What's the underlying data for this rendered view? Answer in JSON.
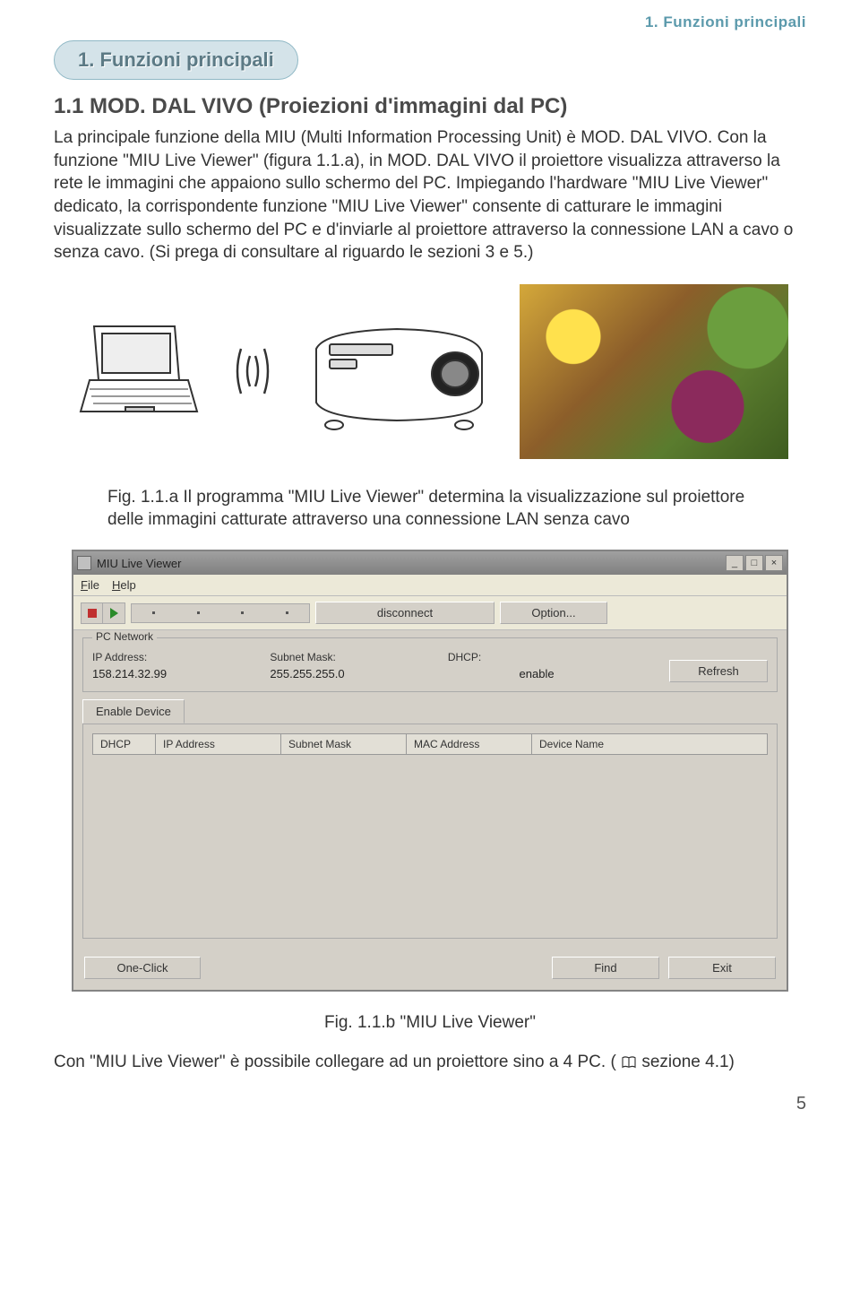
{
  "header": {
    "running_title": "1. Funzioni principali"
  },
  "section_pill": "1. Funzioni principali",
  "section_title": "1.1 MOD. DAL VIVO (Proiezioni d'immagini dal PC)",
  "body_paragraph": "La principale funzione della MIU (Multi Information Processing Unit) è MOD. DAL VIVO.\nCon la funzione \"MIU Live Viewer\" (figura 1.1.a), in MOD. DAL VIVO il proiettore visualizza attraverso la rete le immagini che appaiono sullo schermo del PC. Impiegando l'hardware \"MIU Live Viewer\" dedicato, la corrispondente funzione \"MIU Live Viewer\" consente di catturare le immagini visualizzate sullo schermo del PC e d'inviarle al proiettore attraverso la connessione LAN a cavo o senza cavo. (Si prega di consultare al riguardo le sezioni 3 e 5.)",
  "fig_a_caption": "Fig. 1.1.a Il programma \"MIU Live Viewer\" determina la visualizzazione sul proiettore delle immagini catturate attraverso una connessione LAN senza cavo",
  "app": {
    "title": "MIU Live Viewer",
    "menus": {
      "file": "File",
      "help": "Help"
    },
    "toolbar": {
      "disconnect": "disconnect",
      "option": "Option..."
    },
    "pc_network": {
      "legend": "PC Network",
      "ip_label": "IP Address:",
      "ip_value": "158.214.32.99",
      "subnet_label": "Subnet Mask:",
      "subnet_value": "255.255.255.0",
      "dhcp_label": "DHCP:",
      "dhcp_value": "enable",
      "refresh": "Refresh"
    },
    "tab": {
      "enable_device": "Enable Device"
    },
    "columns": {
      "dhcp": "DHCP",
      "ip": "IP Address",
      "subnet": "Subnet Mask",
      "mac": "MAC Address",
      "device": "Device Name"
    },
    "buttons": {
      "one_click": "One-Click",
      "find": "Find",
      "exit": "Exit"
    }
  },
  "fig_b_caption": "Fig. 1.1.b \"MIU Live Viewer\"",
  "footer_text_1": "Con \"MIU Live Viewer\" è possibile collegare ad un proiettore sino a 4 PC. (",
  "footer_text_2": " sezione 4.1)",
  "page_number": "5"
}
